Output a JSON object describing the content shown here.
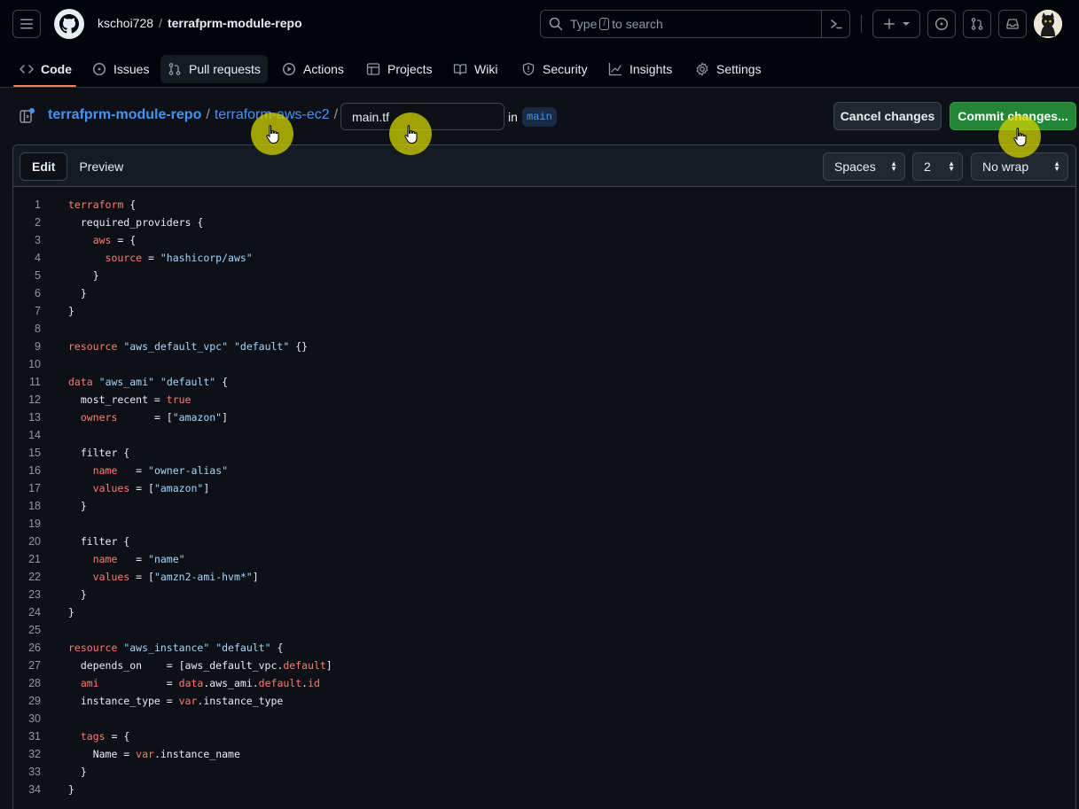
{
  "header": {
    "owner": "kschoi728",
    "repo": "terrafprm-module-repo",
    "search_prefix": "Type",
    "search_key": "/",
    "search_suffix": "to search"
  },
  "tabs": [
    {
      "label": "Code",
      "icon": "code-icon"
    },
    {
      "label": "Issues",
      "icon": "issue-icon"
    },
    {
      "label": "Pull requests",
      "icon": "pull-request-icon"
    },
    {
      "label": "Actions",
      "icon": "play-icon"
    },
    {
      "label": "Projects",
      "icon": "table-icon"
    },
    {
      "label": "Wiki",
      "icon": "book-icon"
    },
    {
      "label": "Security",
      "icon": "shield-icon"
    },
    {
      "label": "Insights",
      "icon": "graph-icon"
    },
    {
      "label": "Settings",
      "icon": "gear-icon"
    }
  ],
  "editor": {
    "repo_link": "terrafprm-module-repo",
    "dir_link": "terraform-aws-ec2",
    "separator": "/",
    "filename": "main.tf",
    "in_label": "in",
    "branch": "main",
    "cancel_label": "Cancel changes",
    "commit_label": "Commit changes...",
    "edit_tab": "Edit",
    "preview_tab": "Preview",
    "indent_mode": "Spaces",
    "indent_size": "2",
    "wrap_mode": "No wrap"
  },
  "colors": {
    "keyword": "#ff7b72",
    "string": "#a5d6ff",
    "commit_button": "#238636",
    "link": "#4493f8"
  },
  "code_lines": [
    "terraform {",
    "  required_providers {",
    "    aws = {",
    "      source = \"hashicorp/aws\"",
    "    }",
    "  }",
    "}",
    "",
    "resource \"aws_default_vpc\" \"default\" {}",
    "",
    "data \"aws_ami\" \"default\" {",
    "  most_recent = true",
    "  owners      = [\"amazon\"]",
    "",
    "  filter {",
    "    name   = \"owner-alias\"",
    "    values = [\"amazon\"]",
    "  }",
    "",
    "  filter {",
    "    name   = \"name\"",
    "    values = [\"amzn2-ami-hvm*\"]",
    "  }",
    "}",
    "",
    "resource \"aws_instance\" \"default\" {",
    "  depends_on    = [aws_default_vpc.default]",
    "  ami           = data.aws_ami.default.id",
    "  instance_type = var.instance_type",
    "",
    "  tags = {",
    "    Name = var.instance_name",
    "  }",
    "}"
  ]
}
